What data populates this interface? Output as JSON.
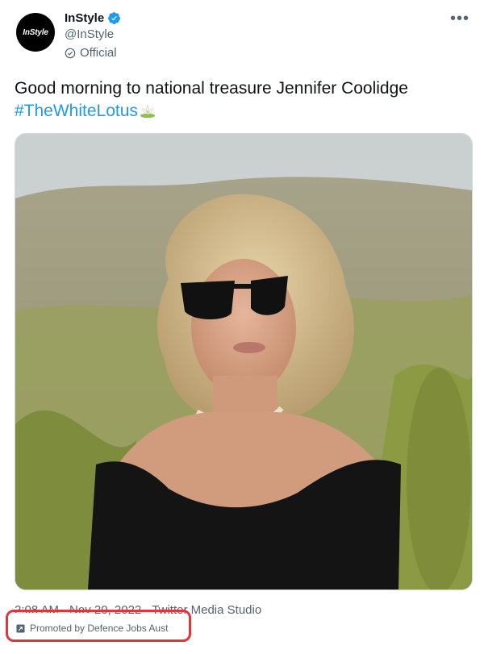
{
  "account": {
    "avatar_text": "InStyle",
    "display_name": "InStyle",
    "handle": "@InStyle",
    "label": "Official"
  },
  "tweet": {
    "text": "Good morning to national treasure Jennifer Coolidge",
    "hashtag": "#TheWhiteLotus"
  },
  "media": {
    "icon": "photo-woman-sunglasses"
  },
  "meta": {
    "time": "2:08 AM",
    "date": "Nov 20, 2022",
    "source": "Twitter Media Studio"
  },
  "promo": {
    "text": "Promoted by Defence Jobs Aust"
  },
  "colors": {
    "accent": "#1d9bf0",
    "highlight": "#e0353a"
  }
}
